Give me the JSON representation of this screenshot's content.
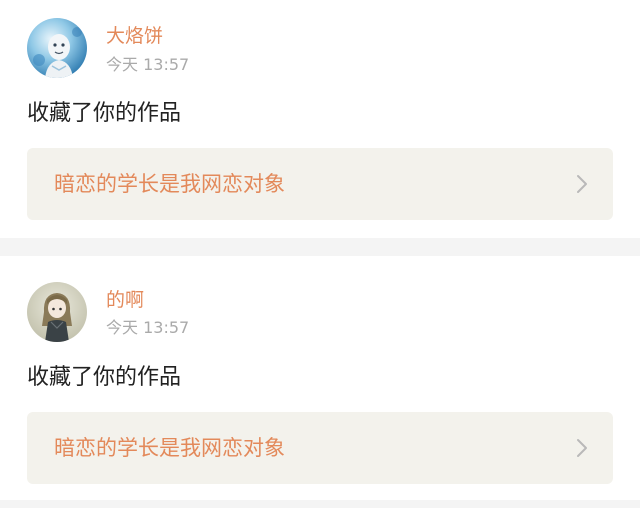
{
  "notifications": [
    {
      "username": "大烙饼",
      "time": "今天 13:57",
      "action": "收藏了你的作品",
      "work_title": "暗恋的学长是我网恋对象",
      "avatar_icon": "user-avatar-blue-figure",
      "chevron_icon": "chevron-right-icon"
    },
    {
      "username": "的啊",
      "time": "今天 13:57",
      "action": "收藏了你的作品",
      "work_title": "暗恋的学长是我网恋对象",
      "avatar_icon": "user-avatar-anime-girl",
      "chevron_icon": "chevron-right-icon"
    }
  ],
  "colors": {
    "accent": "#e3895a",
    "timestamp": "#aaaaaa",
    "body_text": "#222222",
    "link_box": "#f3f2ec",
    "divider": "#f4f4f4"
  }
}
